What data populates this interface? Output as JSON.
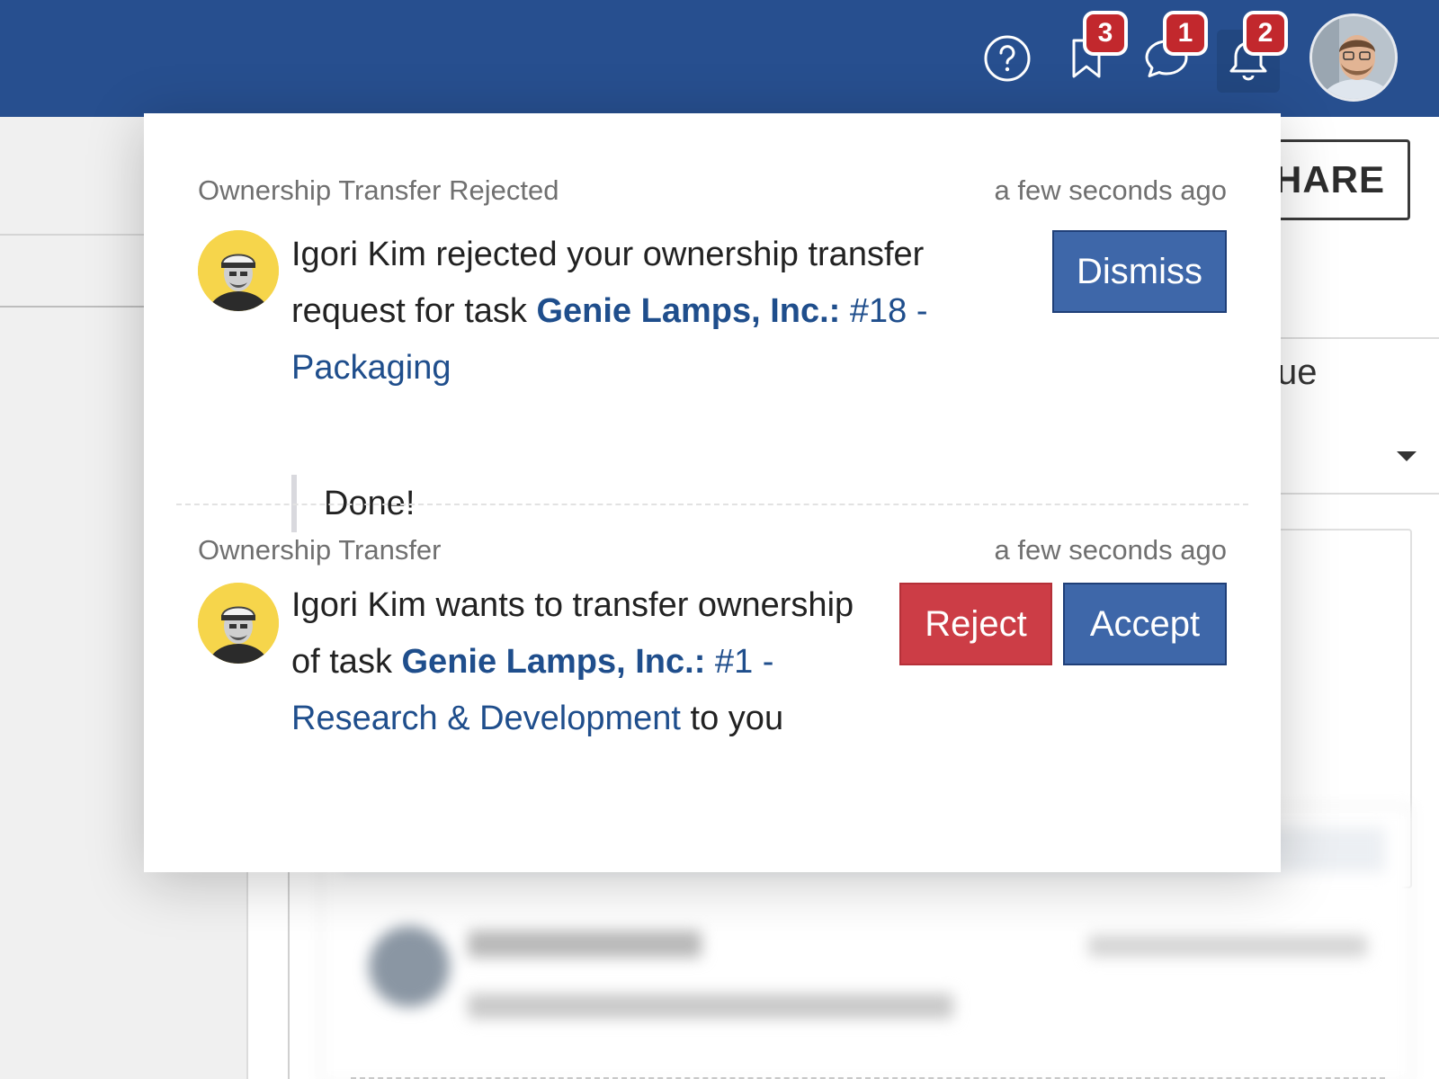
{
  "header": {
    "badges": {
      "bookmarks": "3",
      "messages": "1",
      "notifications": "2"
    },
    "icons": [
      "help-icon",
      "bookmark-icon",
      "chat-icon",
      "bell-icon"
    ]
  },
  "background": {
    "share_label": "SHARE",
    "partial_label": "ue"
  },
  "notifications": [
    {
      "type": "Ownership Transfer Rejected",
      "time": "a few seconds ago",
      "text_before": "Igori Kim rejected your ownership transfer request for task ",
      "link_project": "Genie Lamps, Inc.:",
      "link_task": " #18 - Packaging",
      "quote": "Done!",
      "dismiss_label": "Dismiss"
    },
    {
      "type": "Ownership Transfer",
      "time": "a few seconds ago",
      "text_before": "Igori Kim wants to transfer ownership of task ",
      "link_project": "Genie Lamps, Inc.:",
      "link_task": " #1 - Research & Development",
      "text_after": " to you",
      "reject_label": "Reject",
      "accept_label": "Accept"
    }
  ],
  "colors": {
    "header": "#274f8f",
    "badge": "#c2282d",
    "link": "#1f4e8c",
    "primary_button": "#3e67a9",
    "danger_button": "#cc3d46",
    "avatar_bg": "#f6d54b"
  }
}
